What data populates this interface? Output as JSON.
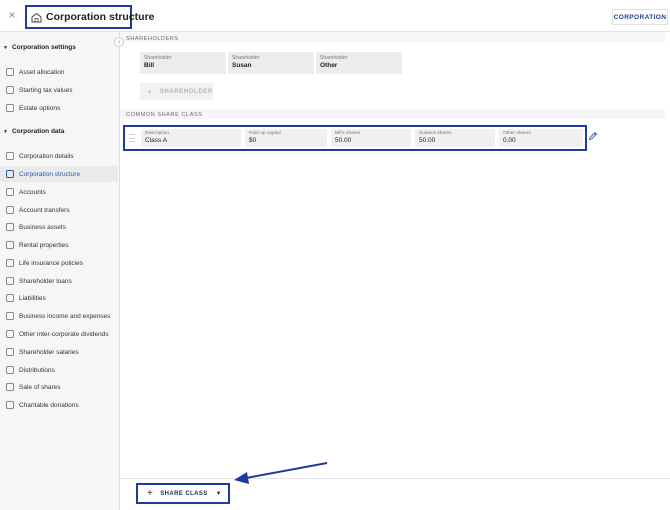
{
  "window": {
    "close_glyph": "×",
    "title": "Corporation structure",
    "title_icon": "corporation-building-icon",
    "badge": "CORPORATION"
  },
  "sidebar": {
    "collapse_glyph": "‹",
    "sections": [
      {
        "title": "Corporation settings",
        "items": [
          {
            "label": "Asset allocation",
            "icon": "pie-chart-icon"
          },
          {
            "label": "Starting tax values",
            "icon": "chart-icon"
          },
          {
            "label": "Estate options",
            "icon": "estate-icon"
          }
        ]
      },
      {
        "title": "Corporation data",
        "items": [
          {
            "label": "Corporation details",
            "icon": "details-icon"
          },
          {
            "label": "Corporation structure",
            "icon": "structure-icon",
            "active": true
          },
          {
            "label": "Accounts",
            "icon": "bank-icon"
          },
          {
            "label": "Account transfers",
            "icon": "transfer-icon"
          },
          {
            "label": "Business assets",
            "icon": "building-icon"
          },
          {
            "label": "Rental properties",
            "icon": "house-icon"
          },
          {
            "label": "Life insurance policies",
            "icon": "umbrella-icon"
          },
          {
            "label": "Shareholder loans",
            "icon": "loan-icon"
          },
          {
            "label": "Liabilities",
            "icon": "liability-icon"
          },
          {
            "label": "Business income and expenses",
            "icon": "income-icon"
          },
          {
            "label": "Other inter-corporate dividends",
            "icon": "dividend-icon"
          },
          {
            "label": "Shareholder salaries",
            "icon": "salary-icon"
          },
          {
            "label": "Distributions",
            "icon": "distribution-icon"
          },
          {
            "label": "Sale of shares",
            "icon": "sale-icon"
          },
          {
            "label": "Charitable donations",
            "icon": "donation-icon"
          }
        ]
      }
    ]
  },
  "main": {
    "shareholders_label": "SHAREHOLDERS",
    "shareholders": [
      {
        "label": "Shareholder",
        "value": "Bill"
      },
      {
        "label": "Shareholder",
        "value": "Susan"
      },
      {
        "label": "Shareholder",
        "value": "Other"
      }
    ],
    "add_shareholder_label": "SHAREHOLDER",
    "common_share_class_label": "COMMON SHARE CLASS",
    "share_class_row": [
      {
        "label": "Description",
        "value": "Class A"
      },
      {
        "label": "Paid-up capital",
        "value": "$0"
      },
      {
        "label": "Bill's shares",
        "value": "50.00"
      },
      {
        "label": "Susan's shares",
        "value": "50.00"
      },
      {
        "label": "Other shares",
        "value": "0.00"
      }
    ]
  },
  "footer": {
    "share_class_button": "SHARE CLASS",
    "plus_glyph": "+",
    "dropdown_glyph": "▼"
  },
  "colors": {
    "highlight_box": "#1c3d9c",
    "active_nav": "#2e59b0",
    "sidebar_bg": "#f6f6f6"
  }
}
